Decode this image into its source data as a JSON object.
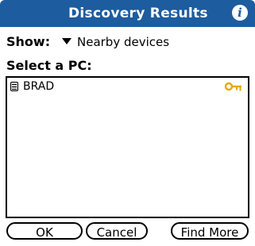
{
  "window": {
    "title": "Discovery Results",
    "info_icon": "i"
  },
  "filter": {
    "label": "Show:",
    "selected": "Nearby devices"
  },
  "pc_list": {
    "label": "Select a PC:",
    "items": [
      {
        "name": "BRAD",
        "icon": "pc-icon",
        "secured": true,
        "badge_icon": "key-icon"
      }
    ]
  },
  "buttons": {
    "ok": "OK",
    "cancel": "Cancel",
    "find_more": "Find More"
  },
  "colors": {
    "title_bar": "#1d5c9e",
    "key": "#e6a800"
  }
}
